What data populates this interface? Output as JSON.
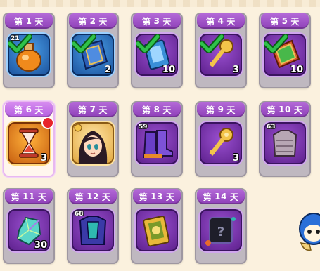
{
  "days": [
    {
      "prefix": "第",
      "num": "1",
      "suffix": "天",
      "qty": "",
      "lvl": "21",
      "claimed": true,
      "icon": "orange-potion-icon"
    },
    {
      "prefix": "第",
      "num": "2",
      "suffix": "天",
      "qty": "2",
      "lvl": "",
      "claimed": true,
      "icon": "blue-spellbook-icon"
    },
    {
      "prefix": "第",
      "num": "3",
      "suffix": "天",
      "qty": "10",
      "lvl": "",
      "claimed": true,
      "icon": "blue-card-icon"
    },
    {
      "prefix": "第",
      "num": "4",
      "suffix": "天",
      "qty": "3",
      "lvl": "",
      "claimed": true,
      "icon": "golden-key-icon"
    },
    {
      "prefix": "第",
      "num": "5",
      "suffix": "天",
      "qty": "10",
      "lvl": "",
      "claimed": true,
      "icon": "green-tome-icon"
    },
    {
      "prefix": "第",
      "num": "6",
      "suffix": "天",
      "qty": "3",
      "lvl": "",
      "claimed": false,
      "today": true,
      "icon": "hourglass-icon"
    },
    {
      "prefix": "第",
      "num": "7",
      "suffix": "天",
      "qty": "",
      "lvl": "",
      "claimed": false,
      "icon": "hero-portrait-icon"
    },
    {
      "prefix": "第",
      "num": "8",
      "suffix": "天",
      "qty": "",
      "lvl": "59",
      "claimed": false,
      "icon": "purple-boots-icon"
    },
    {
      "prefix": "第",
      "num": "9",
      "suffix": "天",
      "qty": "3",
      "lvl": "",
      "claimed": false,
      "icon": "golden-key-icon"
    },
    {
      "prefix": "第",
      "num": "10",
      "suffix": "天",
      "qty": "",
      "lvl": "63",
      "claimed": false,
      "icon": "chainmail-armor-icon"
    },
    {
      "prefix": "第",
      "num": "11",
      "suffix": "天",
      "qty": "30",
      "lvl": "",
      "claimed": false,
      "icon": "crystal-gem-icon"
    },
    {
      "prefix": "第",
      "num": "12",
      "suffix": "天",
      "qty": "",
      "lvl": "68",
      "claimed": false,
      "icon": "armor-chestplate-icon"
    },
    {
      "prefix": "第",
      "num": "13",
      "suffix": "天",
      "qty": "",
      "lvl": "",
      "claimed": false,
      "icon": "golden-card-icon"
    },
    {
      "prefix": "第",
      "num": "14",
      "suffix": "天",
      "qty": "",
      "lvl": "",
      "claimed": false,
      "icon": "mystery-box-icon"
    }
  ],
  "colors": {
    "tab_purple": "#8e3fb8",
    "check_green": "#2fc24a",
    "badge_red": "#e8242a",
    "background": "#fbf1de"
  }
}
